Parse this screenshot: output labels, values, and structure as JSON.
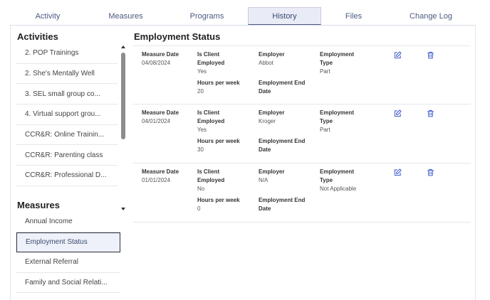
{
  "tabs": [
    {
      "label": "Activity",
      "active": false
    },
    {
      "label": "Measures",
      "active": false
    },
    {
      "label": "Programs",
      "active": false
    },
    {
      "label": "History",
      "active": true
    },
    {
      "label": "Files",
      "active": false
    },
    {
      "label": "Change Log",
      "active": false
    }
  ],
  "sidebar": {
    "activities_title": "Activities",
    "activities": [
      "2. POP Trainings",
      "2. She's Mentally Well",
      "3. SEL small group co...",
      "4. Virtual support grou...",
      "CCR&R: Online Trainin...",
      "CCR&R: Parenting class",
      "CCR&R: Professional D..."
    ],
    "measures_title": "Measures",
    "measures": [
      "Annual Income",
      "Employment Status",
      "External Referral",
      "Family and Social Relati..."
    ],
    "selected_measure": "Employment Status"
  },
  "main": {
    "title": "Employment Status",
    "labels": {
      "measure_date": "Measure Date",
      "is_client_employed": "Is Client Employed",
      "employer": "Employer",
      "employment_type": "Employment Type",
      "hours_per_week": "Hours per week",
      "employment_end_date": "Employment End Date"
    },
    "records": [
      {
        "measure_date": "04/08/2024",
        "is_client_employed": "Yes",
        "employer": "Abbot",
        "employment_type": "Part",
        "hours_per_week": "20",
        "employment_end_date": ""
      },
      {
        "measure_date": "04/01/2024",
        "is_client_employed": "Yes",
        "employer": "Kroger",
        "employment_type": "Part",
        "hours_per_week": "30",
        "employment_end_date": ""
      },
      {
        "measure_date": "01/01/2024",
        "is_client_employed": "No",
        "employer": "N/A",
        "employment_type": "Not Applicable",
        "hours_per_week": "0",
        "employment_end_date": ""
      }
    ]
  },
  "icons": {
    "edit": "edit-icon",
    "delete": "trash-icon"
  },
  "colors": {
    "accent": "#4a5a80",
    "icon": "#3b5bcc",
    "border": "#e4e6ea",
    "selected_bg": "#eef1f9"
  }
}
